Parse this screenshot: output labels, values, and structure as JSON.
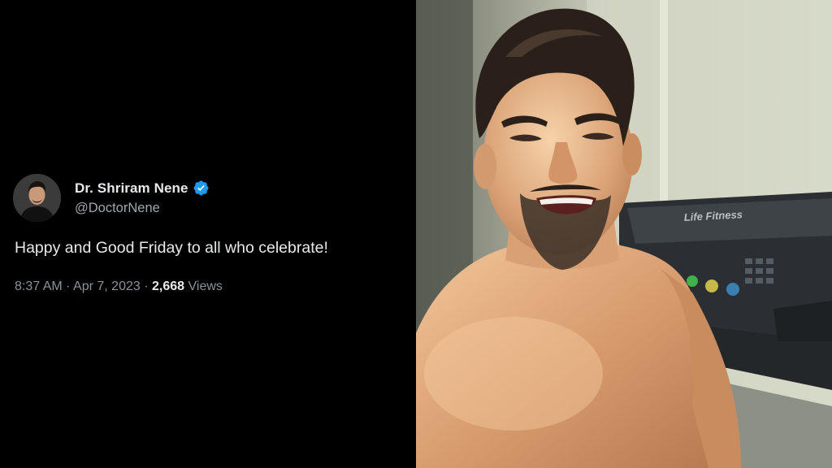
{
  "tweet": {
    "author": {
      "display_name": "Dr. Shriram Nene",
      "handle": "@DoctorNene",
      "verified": true,
      "avatar_icon": "profile-avatar"
    },
    "text": "Happy and Good Friday to all who celebrate!",
    "meta": {
      "time": "8:37 AM",
      "separator": "·",
      "date": "Apr 7, 2023",
      "views_count": "2,668",
      "views_label": "Views"
    }
  },
  "photo": {
    "treadmill_brand": "Life Fitness"
  },
  "colors": {
    "background": "#000000",
    "text_primary": "#e7e9ea",
    "text_secondary": "#8b9298",
    "verified_badge": "#1d9bf0"
  }
}
